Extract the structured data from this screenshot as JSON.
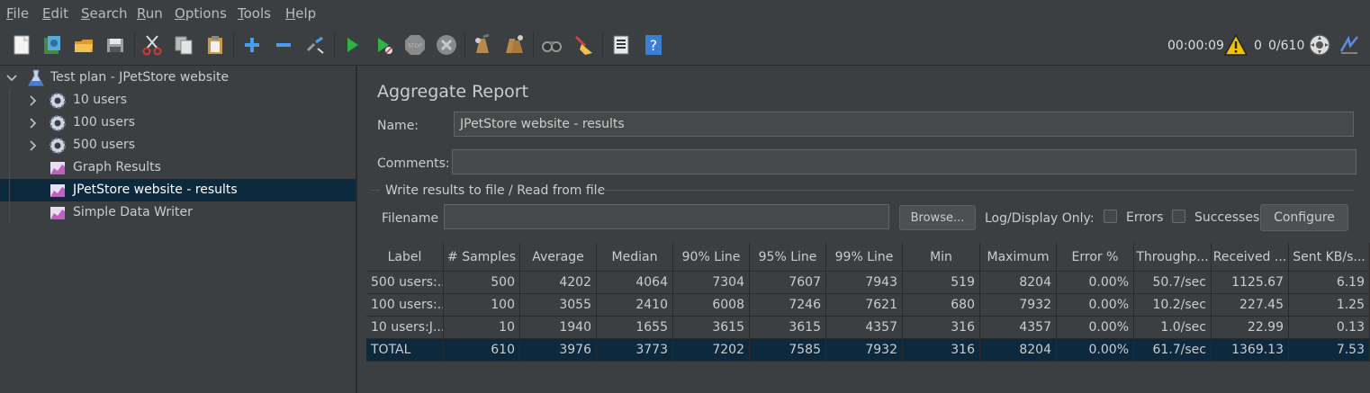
{
  "menu": [
    {
      "u": "F",
      "rest": "ile"
    },
    {
      "u": "E",
      "rest": "dit"
    },
    {
      "u": "S",
      "rest": "earch"
    },
    {
      "u": "R",
      "rest": "un"
    },
    {
      "u": "O",
      "rest": "ptions"
    },
    {
      "u": "T",
      "rest": "ools"
    },
    {
      "u": "H",
      "rest": "elp"
    }
  ],
  "toolbar_icons": [
    "new-icon",
    "templates-icon",
    "open-icon",
    "save-icon",
    "cut-icon",
    "copy-icon",
    "paste-icon",
    "expand-icon",
    "collapse-icon",
    "toggle-icon",
    "start-icon",
    "start-no-pauses-icon",
    "stop-icon",
    "shutdown-icon",
    "clear-icon",
    "clear-all-icon",
    "search-icon",
    "reset-search-icon",
    "function-helper-icon",
    "help-icon"
  ],
  "status": {
    "timer": "00:00:09",
    "warnings": "0",
    "threads": "0/610"
  },
  "tree": {
    "root": "Test plan - JPetStore website",
    "items": [
      {
        "label": "10 users",
        "icon": "gear-icon",
        "expandable": true
      },
      {
        "label": "100 users",
        "icon": "gear-icon",
        "expandable": true
      },
      {
        "label": "500 users",
        "icon": "gear-icon",
        "expandable": true
      },
      {
        "label": "Graph Results",
        "icon": "listener-icon",
        "expandable": false
      },
      {
        "label": "JPetStore website - results",
        "icon": "listener-icon",
        "expandable": false,
        "selected": true
      },
      {
        "label": "Simple Data Writer",
        "icon": "listener-icon",
        "expandable": false
      }
    ]
  },
  "panel": {
    "title": "Aggregate Report",
    "name_label": "Name:",
    "name_value": "JPetStore website - results",
    "comments_label": "Comments:",
    "comments_value": "",
    "group_title": "Write results to file / Read from file",
    "filename_label": "Filename",
    "filename_value": "",
    "browse_button": "Browse...",
    "log_display_label": "Log/Display Only:",
    "errors_label": "Errors",
    "successes_label": "Successes",
    "configure_button": "Configure"
  },
  "table": {
    "headers": [
      "Label",
      "# Samples",
      "Average",
      "Median",
      "90% Line",
      "95% Line",
      "99% Line",
      "Min",
      "Maximum",
      "Error %",
      "Throughp...",
      "Received ...",
      "Sent KB/s..."
    ],
    "rows": [
      [
        "500 users:...",
        "500",
        "4202",
        "4064",
        "7304",
        "7607",
        "7943",
        "519",
        "8204",
        "0.00%",
        "50.7/sec",
        "1125.67",
        "6.19"
      ],
      [
        "100 users:...",
        "100",
        "3055",
        "2410",
        "6008",
        "7246",
        "7621",
        "680",
        "7932",
        "0.00%",
        "10.2/sec",
        "227.45",
        "1.25"
      ],
      [
        "10 users:J...",
        "10",
        "1940",
        "1655",
        "3615",
        "3615",
        "4357",
        "316",
        "4357",
        "0.00%",
        "1.0/sec",
        "22.99",
        "0.13"
      ],
      [
        "TOTAL",
        "610",
        "3976",
        "3773",
        "7202",
        "7585",
        "7932",
        "316",
        "8204",
        "0.00%",
        "61.7/sec",
        "1369.13",
        "7.53"
      ]
    ]
  },
  "colors": {
    "background": "#3c3f41",
    "selection": "#0d293e",
    "text": "#cccccc"
  }
}
